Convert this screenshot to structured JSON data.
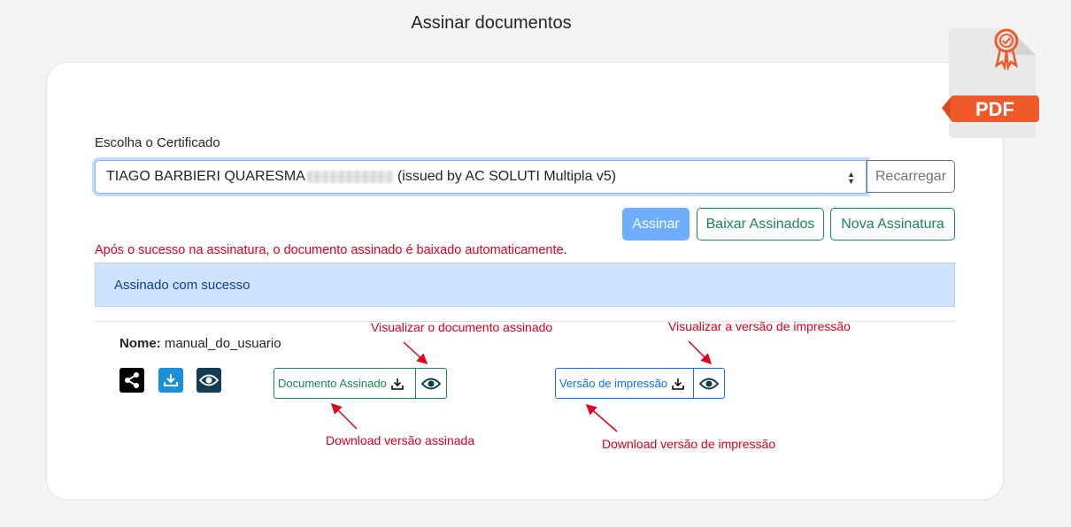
{
  "page": {
    "title": "Assinar documentos"
  },
  "pdf_badge": {
    "label": "PDF"
  },
  "form": {
    "cert_label": "Escolha o Certificado",
    "cert_name": "TIAGO BARBIERI QUARESMA",
    "cert_issuer": "(issued by AC SOLUTI Multipla v5)",
    "reload_label": "Recarregar"
  },
  "actions": {
    "sign_label": "Assinar",
    "download_signed_label": "Baixar Assinados",
    "new_signature_label": "Nova Assinatura"
  },
  "note": "Após o sucesso na assinatura, o documento assinado é baixado automaticamente.",
  "alert": "Assinado com sucesso",
  "document": {
    "name_label": "Nome:",
    "name_value": "manual_do_usuario",
    "signed_btn_label": "Documento Assinado",
    "print_btn_label": "Versão de impressão"
  },
  "annotations": {
    "view_signed": "Visualizar o documento assinado",
    "view_print": "Visualizar a versão de impressão",
    "download_signed": "Download versão assinada",
    "download_print": "Download versão de impressão"
  },
  "colors": {
    "primary": "#0d6efd",
    "success": "#198754",
    "annotation": "#e0001b",
    "pdf_orange": "#f0592a"
  }
}
